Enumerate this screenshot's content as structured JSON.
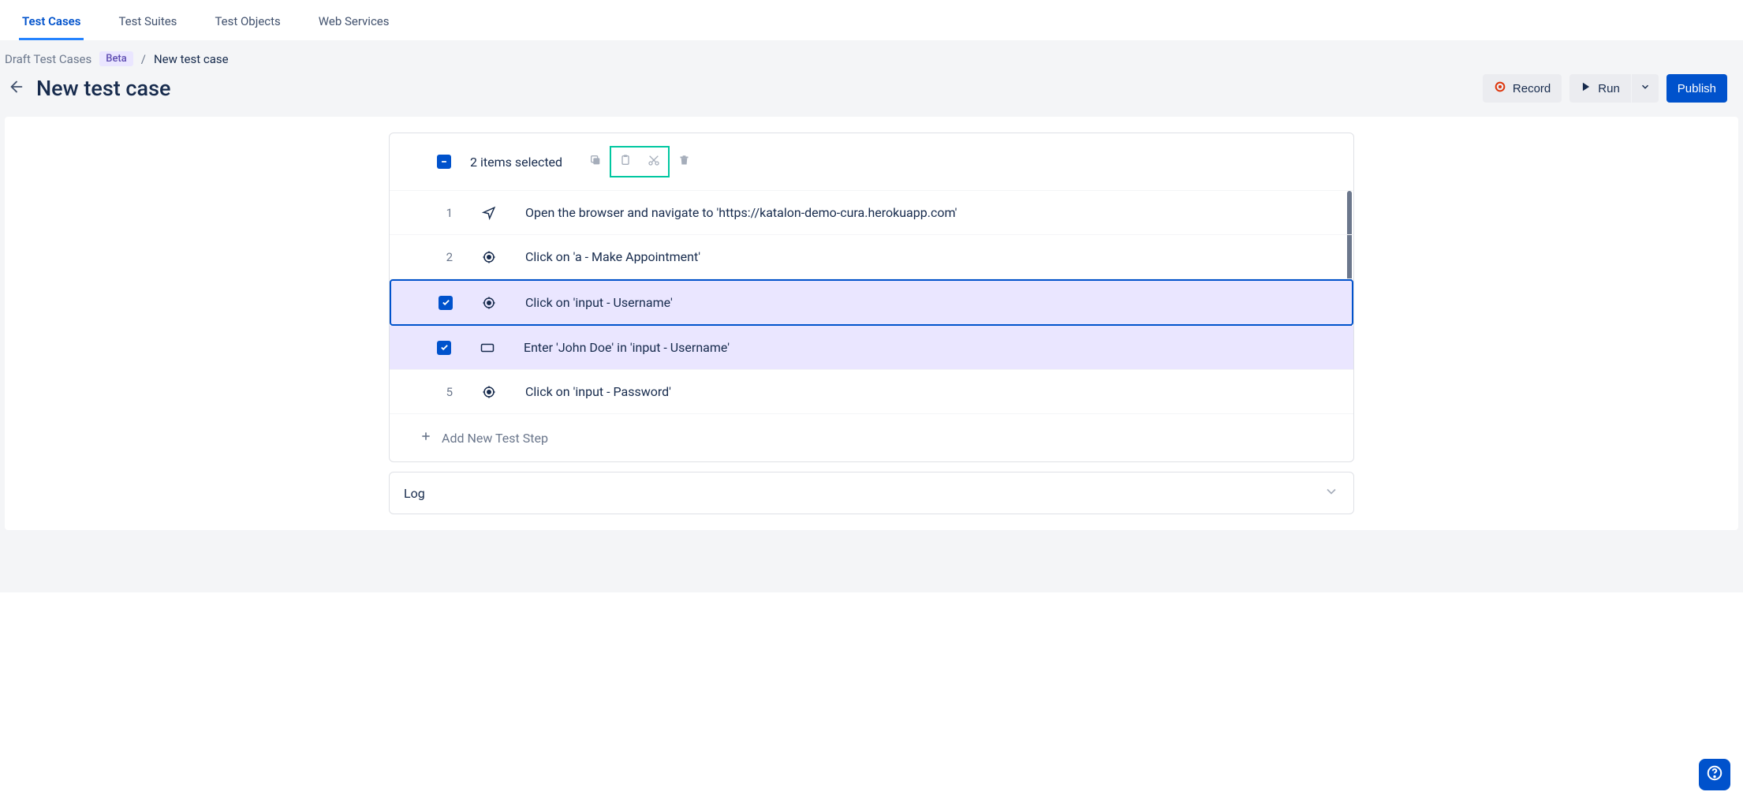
{
  "tabs": [
    {
      "label": "Test Cases",
      "active": true
    },
    {
      "label": "Test Suites",
      "active": false
    },
    {
      "label": "Test Objects",
      "active": false
    },
    {
      "label": "Web Services",
      "active": false
    }
  ],
  "breadcrumb": {
    "root": "Draft Test Cases",
    "badge": "Beta",
    "sep": "/",
    "current": "New test case"
  },
  "page_title": "New test case",
  "actions": {
    "record": "Record",
    "run": "Run",
    "publish": "Publish"
  },
  "selection": {
    "count_text": "2 items selected"
  },
  "steps": [
    {
      "index": "1",
      "icon": "navigate",
      "text": "Open the browser and navigate to 'https://katalon-demo-cura.herokuapp.com'",
      "checked": false,
      "active": false
    },
    {
      "index": "2",
      "icon": "click",
      "text": "Click on 'a - Make Appointment'",
      "checked": false,
      "active": false
    },
    {
      "index": "",
      "icon": "click",
      "text": "Click on 'input - Username'",
      "checked": true,
      "active": true
    },
    {
      "index": "",
      "icon": "input",
      "text": "Enter 'John Doe' in 'input - Username'",
      "checked": true,
      "active": false
    },
    {
      "index": "5",
      "icon": "click",
      "text": "Click on 'input - Password'",
      "checked": false,
      "active": false
    }
  ],
  "add_step_label": "Add New Test Step",
  "log_label": "Log"
}
